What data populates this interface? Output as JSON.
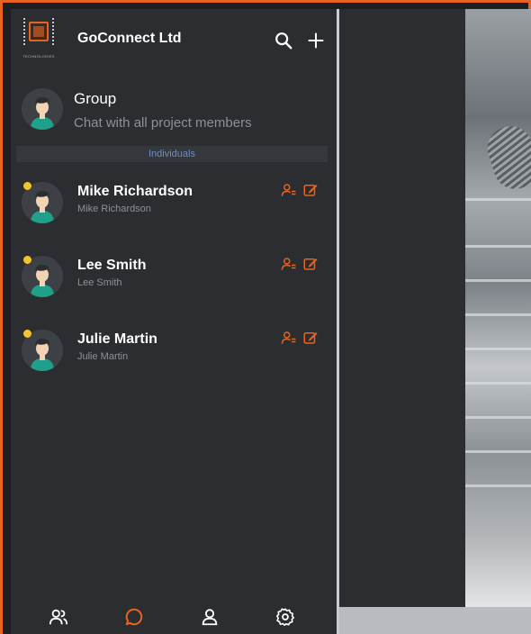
{
  "app": {
    "title": "GoConnect Ltd",
    "logo_text": "TECHNOLOGIES"
  },
  "header": {
    "search_icon": "search-icon",
    "add_icon": "plus-icon"
  },
  "group": {
    "name": "Group",
    "subtitle": "Chat with all project members"
  },
  "section": {
    "label": "Individuals"
  },
  "contacts": [
    {
      "name": "Mike Richardson",
      "subtitle": "Mike Richardson"
    },
    {
      "name": "Lee Smith",
      "subtitle": "Lee Smith"
    },
    {
      "name": "Julie Martin",
      "subtitle": "Julie Martin"
    }
  ],
  "contact_actions": [
    "person-settings-icon",
    "edit-icon"
  ],
  "bottom_nav": [
    "users-icon",
    "chat-icon",
    "profile-icon",
    "settings-icon"
  ],
  "colors": {
    "accent": "#e8641e",
    "panel": "#2b2d30",
    "online": "#f4c430",
    "section_text": "#6e8ec8"
  }
}
